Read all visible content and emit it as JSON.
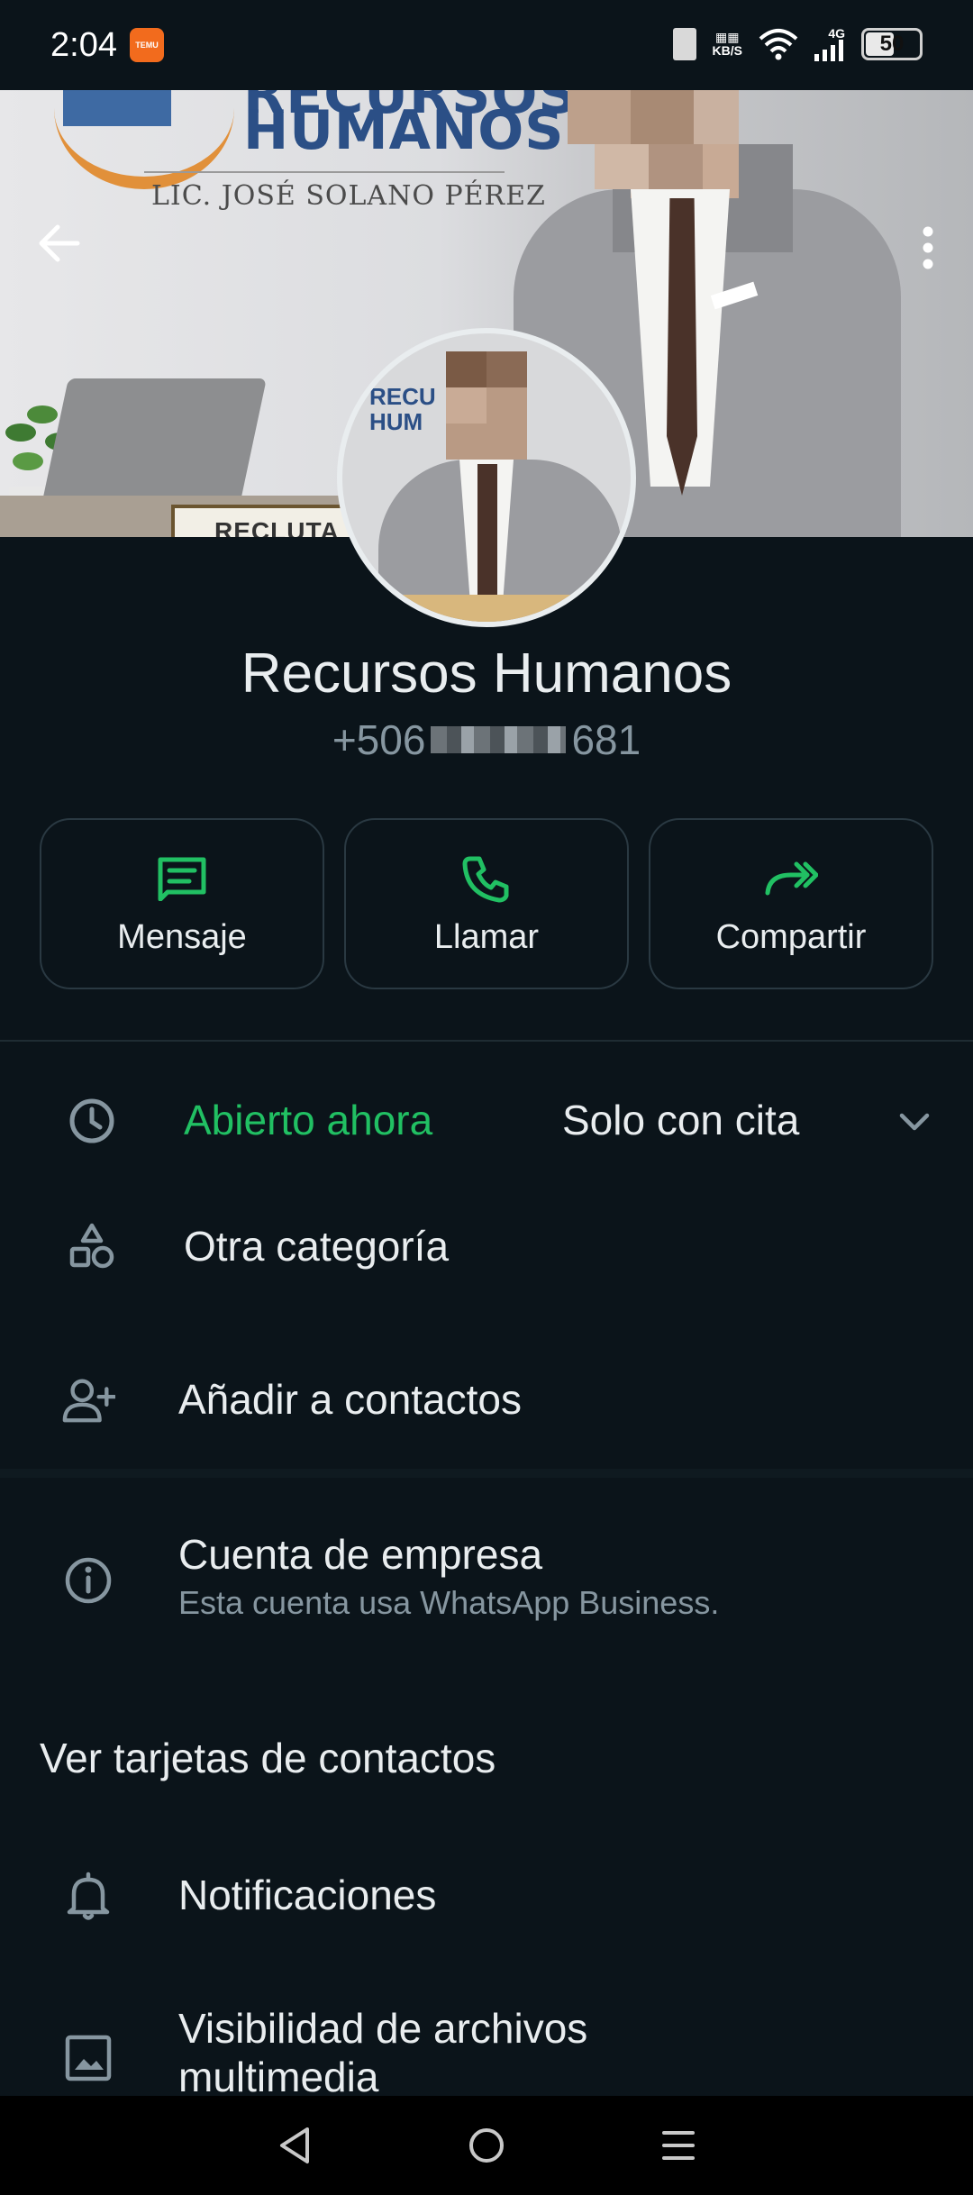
{
  "status_bar": {
    "time": "2:04",
    "app_badge": "TEMU",
    "net_speed_unit": "KB/S",
    "network_type": "4G",
    "battery_level": "50"
  },
  "cover": {
    "logo_line1": "RECURSOS",
    "logo_line2": "HUMANOS",
    "subtitle": "LIC. JOSÉ SOLANO PÉREZ",
    "nameplate": "RECLUTA"
  },
  "avatar": {
    "text_line1": "RECU",
    "text_line2": "HUM"
  },
  "contact": {
    "name": "Recursos Humanos",
    "phone_prefix": "+506",
    "phone_suffix": "681"
  },
  "actions": [
    {
      "label": "Mensaje",
      "icon": "message-icon"
    },
    {
      "label": "Llamar",
      "icon": "phone-icon"
    },
    {
      "label": "Compartir",
      "icon": "share-icon"
    }
  ],
  "hours": {
    "status": "Abierto ahora",
    "note": "Solo con cita"
  },
  "category": "Otra categoría",
  "add_contact": "Añadir a contactos",
  "business": {
    "title": "Cuenta de empresa",
    "subtitle": "Esta cuenta usa WhatsApp Business."
  },
  "contact_cards": "Ver tarjetas de contactos",
  "notifications": "Notificaciones",
  "media_visibility": "Visibilidad de archivos multimedia",
  "colors": {
    "background": "#0b141a",
    "accent_green": "#21c063",
    "text_primary": "#e9edef",
    "text_secondary": "#8696a0"
  }
}
